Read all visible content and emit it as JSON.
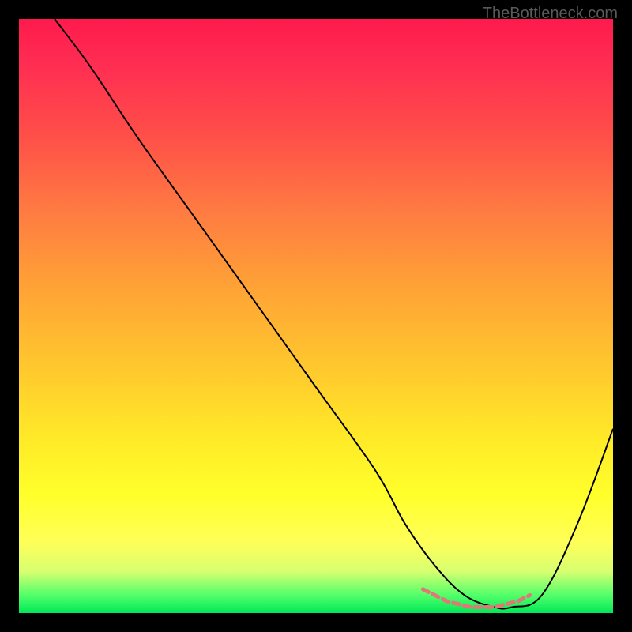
{
  "watermark": "TheBottleneck.com",
  "chart_data": {
    "type": "line",
    "title": "",
    "xlabel": "",
    "ylabel": "",
    "xlim": [
      0,
      100
    ],
    "ylim": [
      0,
      100
    ],
    "series": [
      {
        "name": "bottleneck-curve",
        "x": [
          6,
          12,
          20,
          30,
          40,
          50,
          60,
          65,
          70,
          75,
          80,
          83,
          88,
          94,
          100
        ],
        "y": [
          100,
          92,
          80,
          66,
          52,
          38,
          24,
          15,
          8,
          3,
          1,
          1,
          3,
          15,
          31
        ]
      }
    ],
    "markers": {
      "name": "optimal-range",
      "x": [
        68,
        70,
        72,
        74,
        76,
        78,
        80,
        82,
        84,
        86
      ],
      "y": [
        4,
        3,
        2,
        1.5,
        1,
        1,
        1,
        1.5,
        2,
        3
      ],
      "color": "#e07878"
    },
    "gradient_colors": {
      "top": "#ff1a4d",
      "mid": "#ffe828",
      "bottom": "#00e858"
    }
  }
}
